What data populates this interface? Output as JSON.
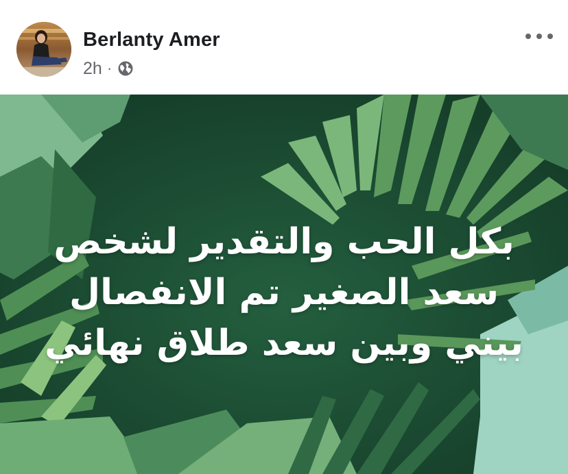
{
  "post": {
    "author_name": "Berlanty Amer",
    "timestamp": "2h",
    "separator": "·",
    "privacy_icon": "globe-icon",
    "more_icon": "more-options-icon",
    "text_lines": [
      "بكل الحب والتقدير لشخص",
      "سعد الصغير تم الانفصال",
      "بيني وبين سعد  طلاق نهائي"
    ]
  },
  "colors": {
    "background_dark": "#1b4d33",
    "leaf_light": "#6fae6e",
    "leaf_mint": "#8fc9b0",
    "secondary_text": "#65676b"
  }
}
